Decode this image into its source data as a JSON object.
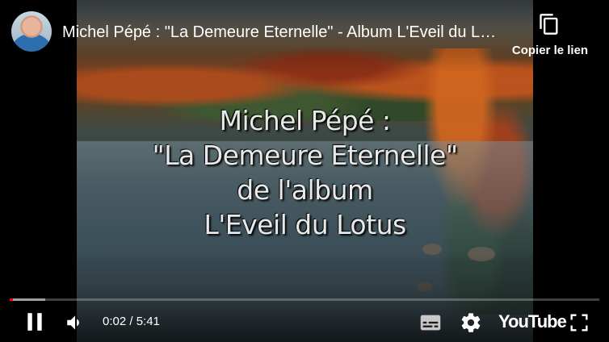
{
  "header": {
    "video_title": "Michel Pépé : \"La Demeure Eternelle\" - Album L'Eveil du Lotus",
    "copy_link_label": "Copier le lien"
  },
  "video": {
    "overlay_lines": [
      "Michel Pépé :",
      "\"La Demeure Eternelle\"",
      "de l'album",
      "L'Eveil du Lotus"
    ]
  },
  "controls": {
    "current_time": "0:02",
    "duration": "5:41",
    "time_display": "0:02 / 5:41",
    "played_fraction": 0.006,
    "buffered_fraction": 0.06,
    "youtube_logo": "YouTube",
    "accent_color": "#ff0000",
    "icons": [
      "pause-icon",
      "volume-icon",
      "subtitles-icon",
      "settings-gear-icon",
      "youtube-logo",
      "fullscreen-icon",
      "copy-link-icon"
    ]
  }
}
